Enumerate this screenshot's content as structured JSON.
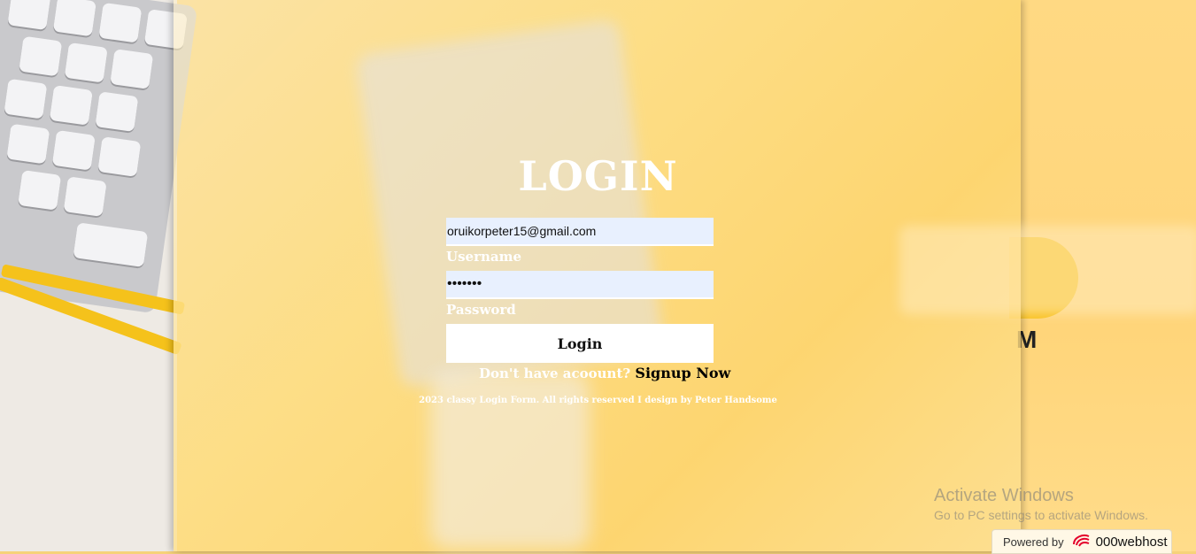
{
  "login": {
    "title": "LOGIN",
    "username_value": "oruikorpeter15@gmail.com",
    "username_label": "Username",
    "password_value": "*******",
    "password_label": "Password",
    "login_button": "Login",
    "signup_prompt": "Don't have acoount?",
    "signup_link": "Signup Now",
    "footer": "2023 classy Login Form. All rights reserved I design by Peter Handsome"
  },
  "os_notice": {
    "title": "Activate Windows",
    "subtitle": "Go to PC settings to activate Windows."
  },
  "host_badge": {
    "prefix": "Powered by",
    "brand": "000webhost",
    "icon": "000webhost-logo-icon"
  },
  "background_text": "M",
  "colors": {
    "accent_yellow": "#f9c11e",
    "input_bg": "#e8f0fe",
    "text_white": "#ffffff"
  }
}
